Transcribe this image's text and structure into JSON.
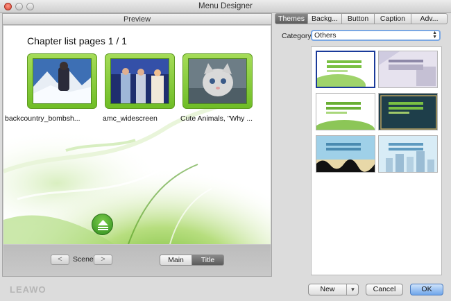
{
  "window": {
    "title": "Menu Designer"
  },
  "preview": {
    "header": "Preview",
    "chapter_title": "Chapter list pages 1 / 1",
    "thumbnails": [
      {
        "label": "backcountry_bombsh..."
      },
      {
        "label": "amc_widescreen"
      },
      {
        "label": "Cute Animals, \"Why ..."
      }
    ]
  },
  "scene_bar": {
    "prev_glyph": "<",
    "next_glyph": ">",
    "scene_label": "Scene",
    "main_label": "Main",
    "title_label": "Title",
    "active_segment": "Title"
  },
  "tabs": [
    {
      "label": "Themes",
      "active": true
    },
    {
      "label": "Backg...",
      "active": false
    },
    {
      "label": "Button",
      "active": false
    },
    {
      "label": "Caption",
      "active": false
    },
    {
      "label": "Adv...",
      "active": false
    }
  ],
  "category": {
    "label": "Category",
    "value": "Others"
  },
  "footer": {
    "logo": "LEAWO",
    "new_label": "New",
    "cancel_label": "Cancel",
    "ok_label": "OK"
  },
  "colors": {
    "accent_green": "#7ac143",
    "select_blue": "#1a3a9a",
    "ok_blue": "#6fa6ea"
  }
}
